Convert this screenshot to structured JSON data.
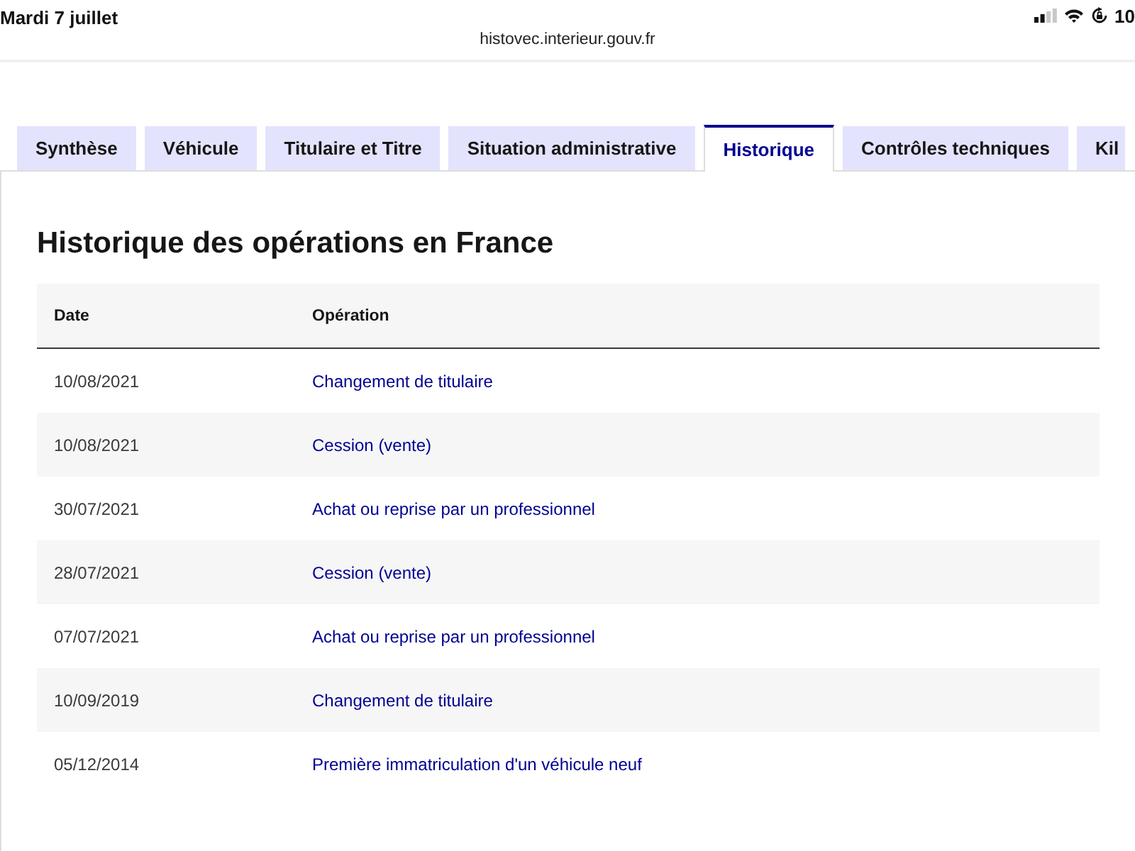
{
  "status_bar": {
    "date": "Mardi 7 juillet",
    "battery": "10"
  },
  "address_bar": {
    "url": "histovec.interieur.gouv.fr"
  },
  "tabs": [
    {
      "label": "Synthèse",
      "selected": false
    },
    {
      "label": "Véhicule",
      "selected": false
    },
    {
      "label": "Titulaire et Titre",
      "selected": false
    },
    {
      "label": "Situation administrative",
      "selected": false
    },
    {
      "label": "Historique",
      "selected": true
    },
    {
      "label": "Contrôles techniques",
      "selected": false
    },
    {
      "label": "Kil",
      "selected": false
    }
  ],
  "section": {
    "title": "Historique des opérations en France",
    "table": {
      "columns": [
        "Date",
        "Opération"
      ],
      "rows": [
        {
          "date": "10/08/2021",
          "operation": "Changement de titulaire"
        },
        {
          "date": "10/08/2021",
          "operation": "Cession (vente)"
        },
        {
          "date": "30/07/2021",
          "operation": "Achat ou reprise par un professionnel"
        },
        {
          "date": "28/07/2021",
          "operation": "Cession (vente)"
        },
        {
          "date": "07/07/2021",
          "operation": "Achat ou reprise par un professionnel"
        },
        {
          "date": "10/09/2019",
          "operation": "Changement de titulaire"
        },
        {
          "date": "05/12/2014",
          "operation": "Première immatriculation d'un véhicule neuf"
        }
      ]
    }
  }
}
